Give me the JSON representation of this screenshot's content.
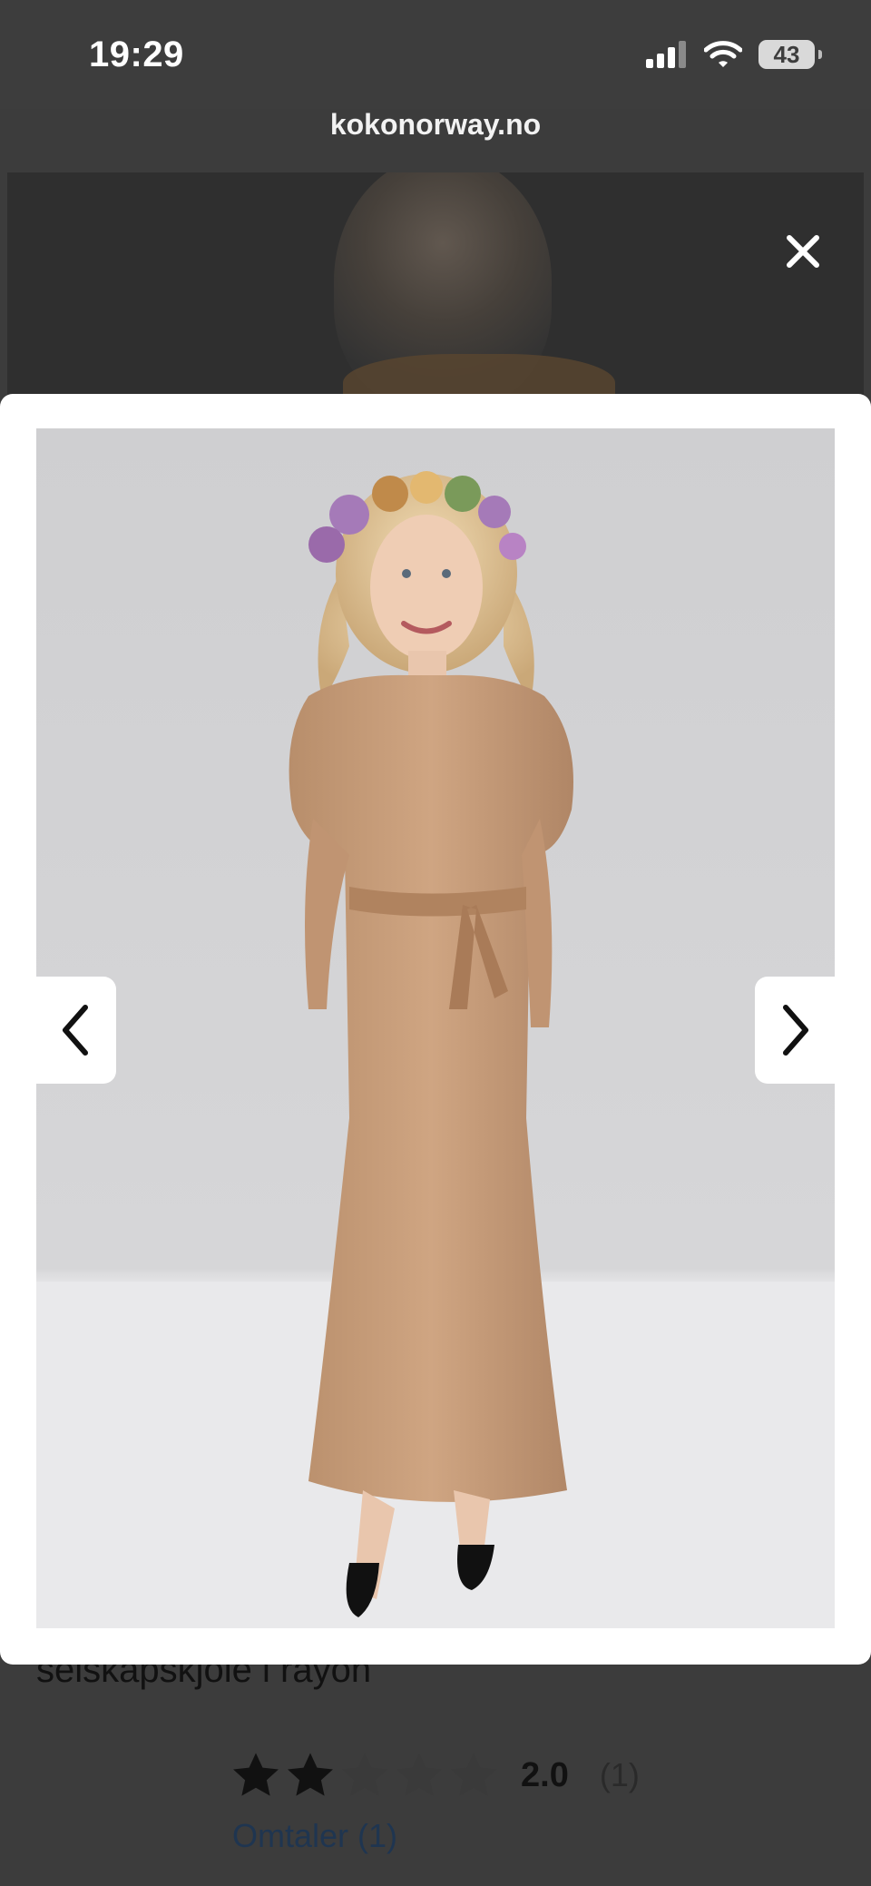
{
  "status_bar": {
    "time": "19:29",
    "battery": "43"
  },
  "browser": {
    "url": "kokonorway.no"
  },
  "product": {
    "title_partial": "selskapskjole i rayon",
    "rating": {
      "value": "2.0",
      "count": "(1)",
      "stars_filled": 2,
      "stars_total": 5
    },
    "reviews_link": "Omtaler (1)"
  },
  "icons": {
    "close": "close-icon",
    "prev": "chevron-left-icon",
    "next": "chevron-right-icon"
  },
  "colors": {
    "overlay": "#3c3c3c",
    "dress": "#c59c78",
    "star_filled": "#111111",
    "star_empty": "#3a3a3a"
  }
}
